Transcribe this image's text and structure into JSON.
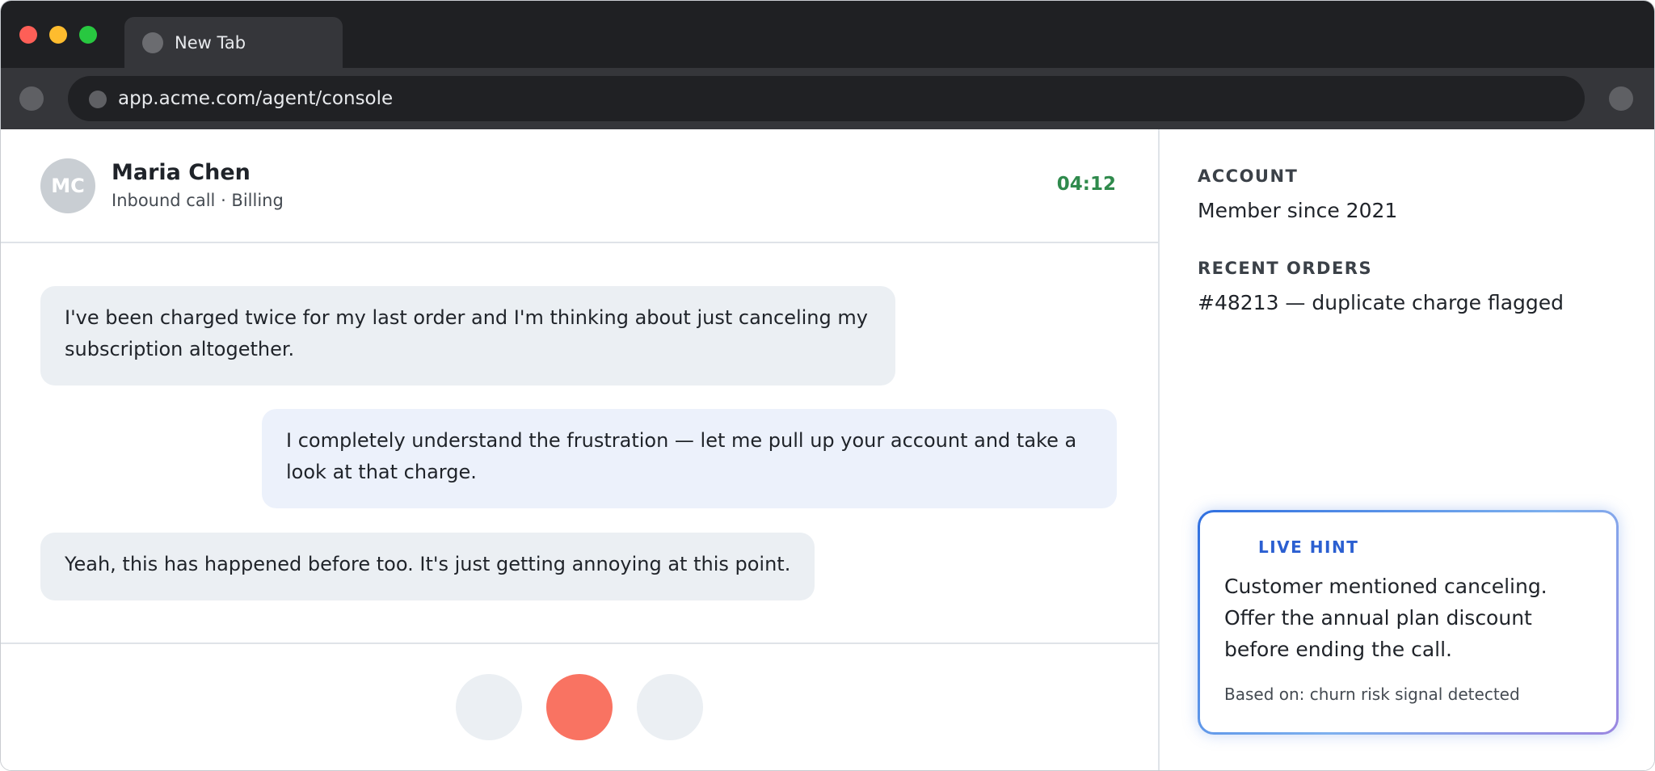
{
  "browser": {
    "tab_title": "New Tab",
    "url": "app.acme.com/agent/console"
  },
  "call": {
    "avatar_initials": "MC",
    "caller_name": "Maria Chen",
    "caller_subtitle": "Inbound call · Billing",
    "timer": "04:12"
  },
  "transcript": [
    {
      "speaker": "customer",
      "text": "I've been charged twice for my last order and I'm thinking about just canceling my subscription altogether."
    },
    {
      "speaker": "agent",
      "text": "I completely understand the frustration — let me pull up your account and take a look at that charge."
    },
    {
      "speaker": "customer",
      "text": "Yeah, this has happened before too. It's just getting annoying at this point."
    }
  ],
  "side_panel": {
    "account_label": "ACCOUNT",
    "account_value": "Member since 2021",
    "orders_label": "RECENT ORDERS",
    "orders_value": "#48213 — duplicate charge flagged"
  },
  "hint": {
    "label": "LIVE HINT",
    "text": "Customer mentioned canceling. Offer the annual plan discount before ending the call.",
    "basis": "Based on: churn risk signal detected"
  },
  "colors": {
    "timer": "#2f8a4c",
    "end_call": "#f97362",
    "hint_accent": "#2b5fd1"
  }
}
